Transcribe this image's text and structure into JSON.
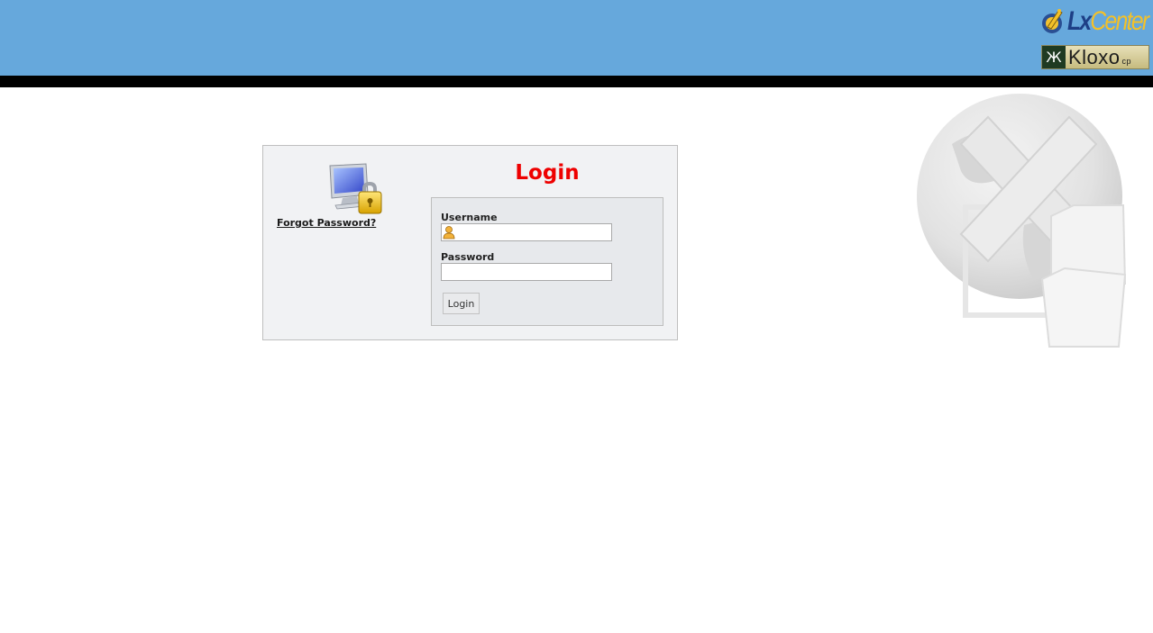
{
  "header": {
    "logo_brand_lx": "Lx",
    "logo_brand_center": "Center",
    "logo_product": "Kloxo",
    "logo_product_suffix": "cp",
    "background_color": "#66a8dc",
    "bar_color": "#000000"
  },
  "login": {
    "title": "Login",
    "forgot_password_label": "Forgot Password?",
    "username_label": "Username",
    "username_value": "",
    "password_label": "Password",
    "password_value": "",
    "submit_label": "Login",
    "title_color": "#ee0000"
  },
  "icons": {
    "header_logo": "lxcenter-logo-icon",
    "product_logo": "kloxo-logo-icon",
    "panel_image": "monitor-lock-icon",
    "username_prefix": "user-icon",
    "background_art": "globe-folder-watermark"
  }
}
